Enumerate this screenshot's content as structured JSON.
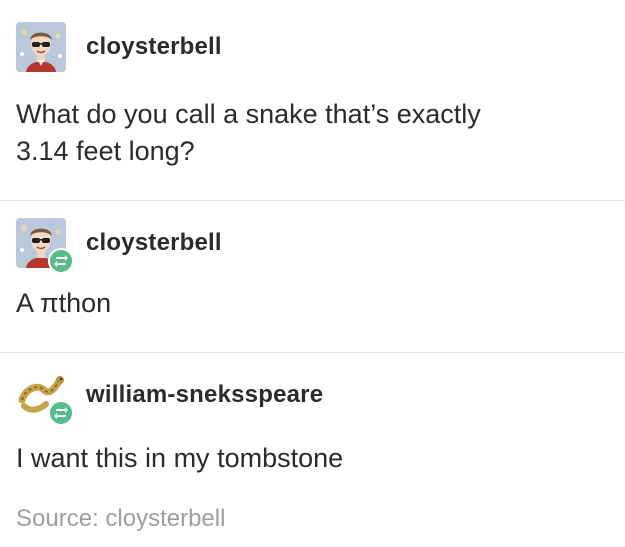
{
  "posts": [
    {
      "username": "cloysterbell",
      "text_line1": "What do you call a snake that’s exactly",
      "text_line2": "3.14 feet long?",
      "avatar_icon": "person-with-sunglasses-avatar",
      "reblog": false
    },
    {
      "username": "cloysterbell",
      "text": "A πthon",
      "avatar_icon": "person-with-sunglasses-avatar",
      "reblog": true,
      "reblog_icon": "reblog-icon"
    },
    {
      "username": "william-sneksspeare",
      "text": "I want this in my tombstone",
      "avatar_icon": "snake-avatar",
      "reblog": true,
      "reblog_icon": "reblog-icon"
    }
  ],
  "source": {
    "label": "Source: ",
    "link": "cloysterbell"
  },
  "colors": {
    "text": "#2b2b2b",
    "muted": "#9e9e9e",
    "reblog_green": "#56bc8a",
    "divider": "#e6e6e6"
  }
}
